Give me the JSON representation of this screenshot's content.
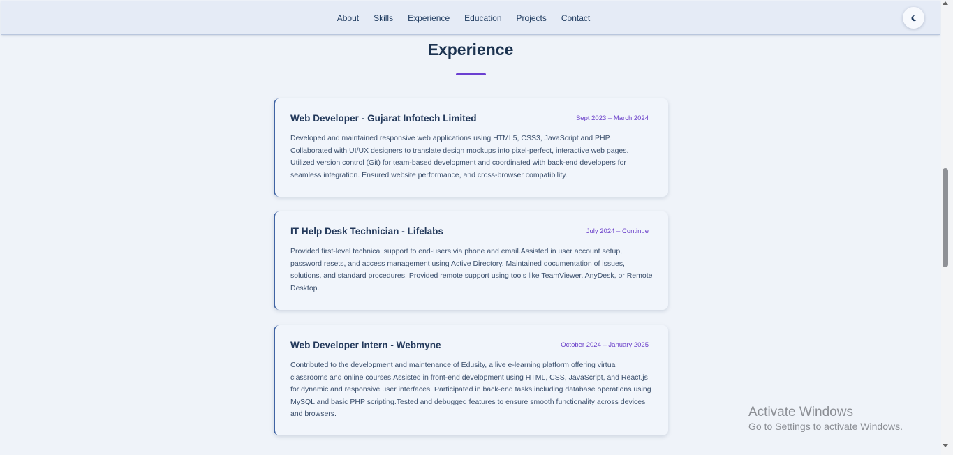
{
  "nav": {
    "links": [
      "About",
      "Skills",
      "Experience",
      "Education",
      "Projects",
      "Contact"
    ],
    "theme_toggle_icon": "moon-icon"
  },
  "section": {
    "title": "Experience"
  },
  "experience": [
    {
      "title": "Web Developer - Gujarat Infotech Limited",
      "date": "Sept 2023 – March 2024",
      "description": "Developed and maintained responsive web applications using HTML5, CSS3, JavaScript and PHP. Collaborated with UI/UX designers to translate design mockups into pixel-perfect, interactive web pages. Utilized version control (Git) for team-based development and coordinated with back-end developers for seamless integration. Ensured website performance, and cross-browser compatibility."
    },
    {
      "title": "IT Help Desk Technician - Lifelabs",
      "date": "July 2024 – Continue",
      "description": "Provided first-level technical support to end-users via phone and email.Assisted in user account setup, password resets, and access management using Active Directory. Maintained documentation of issues, solutions, and standard procedures. Provided remote support using tools like TeamViewer, AnyDesk, or Remote Desktop."
    },
    {
      "title": "Web Developer Intern - Webmyne",
      "date": "October 2024 – January 2025",
      "description": "Contributed to the development and maintenance of Edusity, a live e-learning platform offering virtual classrooms and online courses.Assisted in front-end development using HTML, CSS, JavaScript, and React.js for dynamic and responsive user interfaces. Participated in back-end tasks including database operations using MySQL and basic PHP scripting.Tested and debugged features to ensure smooth functionality across devices and browsers."
    }
  ],
  "watermark": {
    "title": "Activate Windows",
    "subtitle": "Go to Settings to activate Windows."
  },
  "colors": {
    "accent": "#6b3fd1",
    "card_border": "#3f63a3",
    "heading": "#1c3350",
    "background": "#eff3f9"
  }
}
